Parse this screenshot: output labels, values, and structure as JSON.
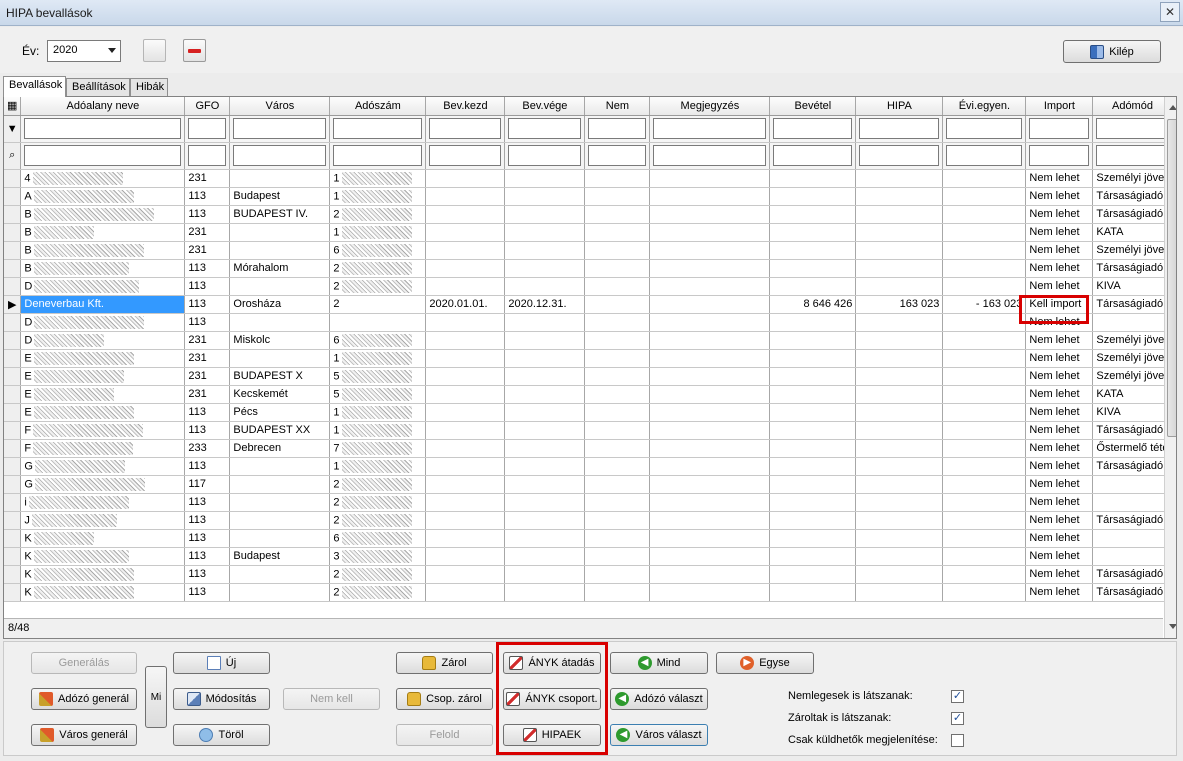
{
  "window": {
    "title": "HIPA bevallások",
    "close_glyph": "✕"
  },
  "toolbar": {
    "year_label": "Év:",
    "year_value": "2020",
    "exit_label": "Kilép"
  },
  "tabs": [
    {
      "label": "Bevallások",
      "active": true
    },
    {
      "label": "Beállítások",
      "active": false
    },
    {
      "label": "Hibák",
      "active": false
    }
  ],
  "grid": {
    "columns": [
      "Adóalany neve",
      "GFO",
      "Város",
      "Adószám",
      "Bev.kezd",
      "Bev.vége",
      "Nem",
      "Megjegyzés",
      "Bevétel",
      "HIPA",
      "Évi.egyen.",
      "Import",
      "Adómód"
    ],
    "rows": [
      {
        "name": "4",
        "gfo": "231",
        "city": "",
        "tax": "1",
        "start": "",
        "end": "",
        "nem": "",
        "note": "",
        "revenue": "",
        "hipa": "",
        "yearly": "",
        "import": "Nem lehet",
        "mode": "Személyi jöve"
      },
      {
        "name": "A",
        "gfo": "113",
        "city": "Budapest",
        "tax": "1",
        "start": "",
        "end": "",
        "nem": "",
        "note": "",
        "revenue": "",
        "hipa": "",
        "yearly": "",
        "import": "Nem lehet",
        "mode": "Társaságiadó"
      },
      {
        "name": "B",
        "gfo": "113",
        "city": "BUDAPEST IV.",
        "tax": "2",
        "start": "",
        "end": "",
        "nem": "",
        "note": "",
        "revenue": "",
        "hipa": "",
        "yearly": "",
        "import": "Nem lehet",
        "mode": "Társaságiadó"
      },
      {
        "name": "B",
        "gfo": "231",
        "city": "",
        "tax": "1",
        "start": "",
        "end": "",
        "nem": "",
        "note": "",
        "revenue": "",
        "hipa": "",
        "yearly": "",
        "import": "Nem lehet",
        "mode": "KATA"
      },
      {
        "name": "B",
        "gfo": "231",
        "city": "",
        "tax": "6",
        "start": "",
        "end": "",
        "nem": "",
        "note": "",
        "revenue": "",
        "hipa": "",
        "yearly": "",
        "import": "Nem lehet",
        "mode": "Személyi jöve"
      },
      {
        "name": "B",
        "gfo": "113",
        "city": "Mórahalom",
        "tax": "2",
        "start": "",
        "end": "",
        "nem": "",
        "note": "",
        "revenue": "",
        "hipa": "",
        "yearly": "",
        "import": "Nem lehet",
        "mode": "Társaságiadó"
      },
      {
        "name": "D",
        "gfo": "113",
        "city": "",
        "tax": "2",
        "start": "",
        "end": "",
        "nem": "",
        "note": "",
        "revenue": "",
        "hipa": "",
        "yearly": "",
        "import": "Nem lehet",
        "mode": "KIVA"
      },
      {
        "name": "Deneverbau Kft.",
        "gfo": "113",
        "city": "Orosháza",
        "tax": "2",
        "start": "2020.01.01.",
        "end": "2020.12.31.",
        "nem": "",
        "note": "",
        "revenue": "8 646 426",
        "hipa": "163 023",
        "yearly": "- 163 023",
        "import": "Kell import",
        "mode": "Társaságiadó",
        "selected": true
      },
      {
        "name": "D",
        "gfo": "113",
        "city": "",
        "tax": "",
        "start": "",
        "end": "",
        "nem": "",
        "note": "",
        "revenue": "",
        "hipa": "",
        "yearly": "",
        "import": "Nem lehet",
        "mode": ""
      },
      {
        "name": "D",
        "gfo": "231",
        "city": "Miskolc",
        "tax": "6",
        "start": "",
        "end": "",
        "nem": "",
        "note": "",
        "revenue": "",
        "hipa": "",
        "yearly": "",
        "import": "Nem lehet",
        "mode": "Személyi jöve"
      },
      {
        "name": "E",
        "gfo": "231",
        "city": "",
        "tax": "1",
        "start": "",
        "end": "",
        "nem": "",
        "note": "",
        "revenue": "",
        "hipa": "",
        "yearly": "",
        "import": "Nem lehet",
        "mode": "Személyi jöve"
      },
      {
        "name": "E",
        "gfo": "231",
        "city": "BUDAPEST X",
        "tax": "5",
        "start": "",
        "end": "",
        "nem": "",
        "note": "",
        "revenue": "",
        "hipa": "",
        "yearly": "",
        "import": "Nem lehet",
        "mode": "Személyi jöve"
      },
      {
        "name": "E",
        "gfo": "231",
        "city": "Kecskemét",
        "tax": "5",
        "start": "",
        "end": "",
        "nem": "",
        "note": "",
        "revenue": "",
        "hipa": "",
        "yearly": "",
        "import": "Nem lehet",
        "mode": "KATA"
      },
      {
        "name": "E",
        "gfo": "113",
        "city": "Pécs",
        "tax": "1",
        "start": "",
        "end": "",
        "nem": "",
        "note": "",
        "revenue": "",
        "hipa": "",
        "yearly": "",
        "import": "Nem lehet",
        "mode": "KIVA"
      },
      {
        "name": "F",
        "gfo": "113",
        "city": "BUDAPEST XX",
        "tax": "1",
        "start": "",
        "end": "",
        "nem": "",
        "note": "",
        "revenue": "",
        "hipa": "",
        "yearly": "",
        "import": "Nem lehet",
        "mode": "Társaságiadó"
      },
      {
        "name": "F",
        "gfo": "233",
        "city": "Debrecen",
        "tax": "7",
        "start": "",
        "end": "",
        "nem": "",
        "note": "",
        "revenue": "",
        "hipa": "",
        "yearly": "",
        "import": "Nem lehet",
        "mode": "Őstermelő téte"
      },
      {
        "name": "G",
        "gfo": "113",
        "city": "",
        "tax": "1",
        "start": "",
        "end": "",
        "nem": "",
        "note": "",
        "revenue": "",
        "hipa": "",
        "yearly": "",
        "import": "Nem lehet",
        "mode": "Társaságiadó"
      },
      {
        "name": "G",
        "gfo": "117",
        "city": "",
        "tax": "2",
        "start": "",
        "end": "",
        "nem": "",
        "note": "",
        "revenue": "",
        "hipa": "",
        "yearly": "",
        "import": "Nem lehet",
        "mode": ""
      },
      {
        "name": "i",
        "gfo": "113",
        "city": "",
        "tax": "2",
        "start": "",
        "end": "",
        "nem": "",
        "note": "",
        "revenue": "",
        "hipa": "",
        "yearly": "",
        "import": "Nem lehet",
        "mode": ""
      },
      {
        "name": "J",
        "gfo": "113",
        "city": "",
        "tax": "2",
        "start": "",
        "end": "",
        "nem": "",
        "note": "",
        "revenue": "",
        "hipa": "",
        "yearly": "",
        "import": "Nem lehet",
        "mode": "Társaságiadó"
      },
      {
        "name": "K",
        "gfo": "113",
        "city": "",
        "tax": "6",
        "start": "",
        "end": "",
        "nem": "",
        "note": "",
        "revenue": "",
        "hipa": "",
        "yearly": "",
        "import": "Nem lehet",
        "mode": ""
      },
      {
        "name": "K",
        "gfo": "113",
        "city": "Budapest",
        "tax": "3",
        "start": "",
        "end": "",
        "nem": "",
        "note": "",
        "revenue": "",
        "hipa": "",
        "yearly": "",
        "import": "Nem lehet",
        "mode": ""
      },
      {
        "name": "K",
        "gfo": "113",
        "city": "",
        "tax": "2",
        "start": "",
        "end": "",
        "nem": "",
        "note": "",
        "revenue": "",
        "hipa": "",
        "yearly": "",
        "import": "Nem lehet",
        "mode": "Társaságiadó"
      },
      {
        "name": "K",
        "gfo": "113",
        "city": "",
        "tax": "2",
        "start": "",
        "end": "",
        "nem": "",
        "note": "",
        "revenue": "",
        "hipa": "",
        "yearly": "",
        "import": "Nem lehet",
        "mode": "Társaságiadó"
      }
    ],
    "status": "8/48"
  },
  "buttons": {
    "generate": "Generálás",
    "new": "Új",
    "taxpayer_generate": "Adózó generál",
    "mi": "Mi",
    "modify": "Módosítás",
    "not_needed": "Nem kell",
    "city_generate": "Város generál",
    "delete": "Töröl",
    "lock": "Zárol",
    "group_lock": "Csop. zárol",
    "unlock": "Felold",
    "anyk_transfer": "ÁNYK átadás",
    "anyk_group": "ÁNYK csoport.",
    "hipaek": "HIPAEK",
    "all": "Mind",
    "taxpayer_select": "Adózó választ",
    "city_select": "Város választ",
    "single": "Egyse"
  },
  "options": [
    {
      "label": "Nemlegesek is látszanak:",
      "checked": true
    },
    {
      "label": "Zároltak is látszanak:",
      "checked": true
    },
    {
      "label": "Csak küldhetők megjelenítése:",
      "checked": false
    }
  ],
  "icons": {
    "exit": "door-icon",
    "new": "document-icon",
    "lock": "lock-icon",
    "anyk": "pen-icon",
    "generate": "wand-icon",
    "modify": "edit-icon",
    "delete": "delete-icon",
    "all": "green-arrow-icon",
    "single": "orange-arrow-icon"
  },
  "colors": {
    "selection": "#3399ff",
    "highlight": "#d80000"
  }
}
